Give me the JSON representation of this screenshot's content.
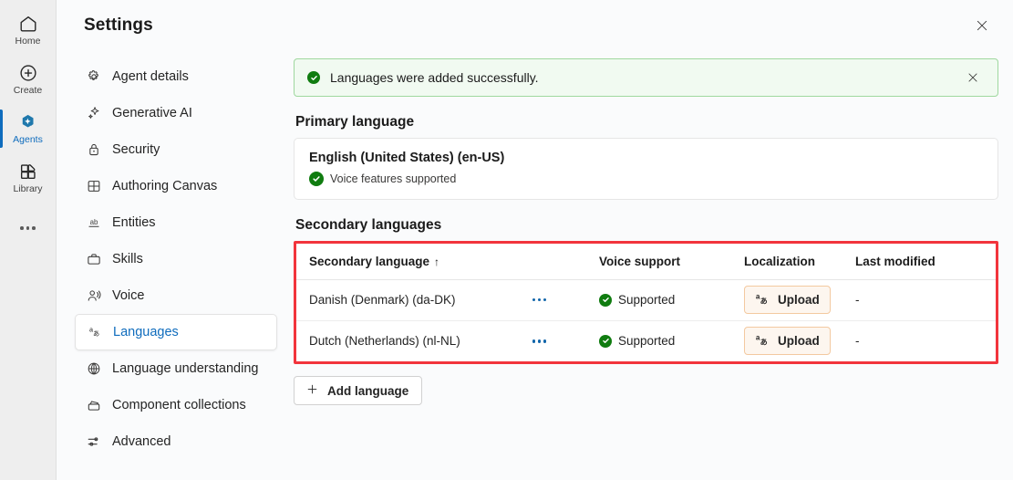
{
  "rail": {
    "items": [
      {
        "label": "Home",
        "icon": "home-icon",
        "selected": false
      },
      {
        "label": "Create",
        "icon": "plus-circle-icon",
        "selected": false
      },
      {
        "label": "Agents",
        "icon": "agents-sparkle-icon",
        "selected": true
      },
      {
        "label": "Library",
        "icon": "library-icon",
        "selected": false
      }
    ],
    "more_label": "More"
  },
  "header": {
    "title": "Settings",
    "close_label": "Close"
  },
  "settings_nav": {
    "items": [
      {
        "label": "Agent details",
        "icon": "gear-icon",
        "selected": false
      },
      {
        "label": "Generative AI",
        "icon": "sparkle-icon",
        "selected": false
      },
      {
        "label": "Security",
        "icon": "lock-icon",
        "selected": false
      },
      {
        "label": "Authoring Canvas",
        "icon": "canvas-grid-icon",
        "selected": false
      },
      {
        "label": "Entities",
        "icon": "ab-underline-icon",
        "selected": false
      },
      {
        "label": "Skills",
        "icon": "briefcase-icon",
        "selected": false
      },
      {
        "label": "Voice",
        "icon": "voice-person-icon",
        "selected": false
      },
      {
        "label": "Languages",
        "icon": "translate-icon",
        "selected": true
      },
      {
        "label": "Language understanding",
        "icon": "globe-brain-icon",
        "selected": false
      },
      {
        "label": "Component collections",
        "icon": "collections-icon",
        "selected": false
      },
      {
        "label": "Advanced",
        "icon": "sliders-icon",
        "selected": false
      }
    ]
  },
  "alert": {
    "message": "Languages were added successfully.",
    "icon": "success-check-icon",
    "dismiss_label": "Dismiss",
    "bg_color": "#f1faf1",
    "border_color": "#9fd89f",
    "accent_color": "#107c10"
  },
  "primary_language": {
    "section_title": "Primary language",
    "name": "English (United States) (en-US)",
    "voice_status": "Voice features supported",
    "voice_status_icon": "success-check-icon"
  },
  "secondary_languages": {
    "section_title": "Secondary languages",
    "highlight_color": "#f2343c",
    "columns": [
      {
        "label": "Secondary language",
        "sort": "↑"
      },
      {
        "label": "Voice support",
        "sort": ""
      },
      {
        "label": "Localization",
        "sort": ""
      },
      {
        "label": "Last modified",
        "sort": ""
      }
    ],
    "rows": [
      {
        "language": "Danish (Denmark) (da-DK)",
        "voice_support": "Supported",
        "voice_icon": "success-check-icon",
        "localization_button": "Upload",
        "localization_icon": "translate-icon",
        "last_modified": "-"
      },
      {
        "language": "Dutch (Netherlands) (nl-NL)",
        "voice_support": "Supported",
        "voice_icon": "success-check-icon",
        "localization_button": "Upload",
        "localization_icon": "translate-icon",
        "last_modified": "-"
      }
    ],
    "add_button": "Add language",
    "add_button_icon": "plus-icon"
  }
}
